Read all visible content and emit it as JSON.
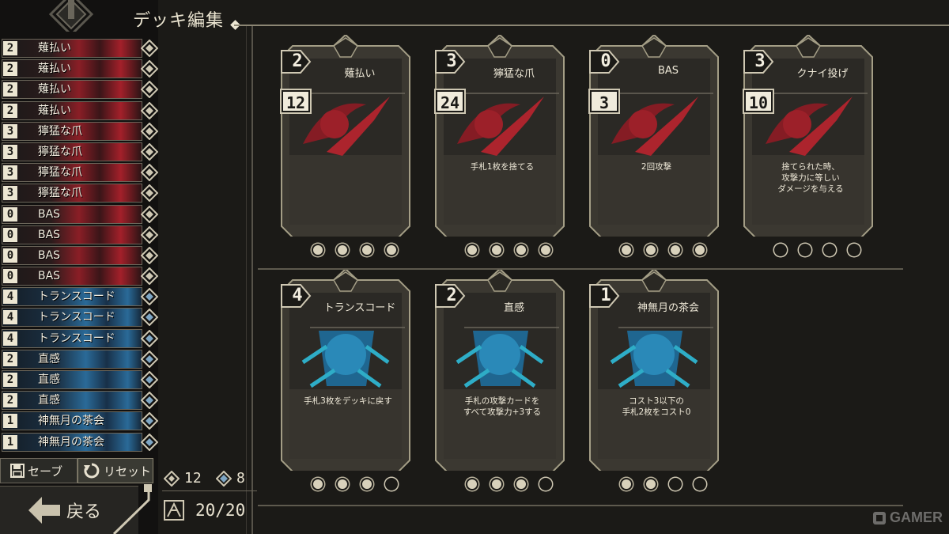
{
  "title": "デッキ編集",
  "deck_list": [
    {
      "cost": "2",
      "name": "薙払い",
      "color": "red"
    },
    {
      "cost": "2",
      "name": "薙払い",
      "color": "red"
    },
    {
      "cost": "2",
      "name": "薙払い",
      "color": "red"
    },
    {
      "cost": "2",
      "name": "薙払い",
      "color": "red"
    },
    {
      "cost": "3",
      "name": "獰猛な爪",
      "color": "red"
    },
    {
      "cost": "3",
      "name": "獰猛な爪",
      "color": "red"
    },
    {
      "cost": "3",
      "name": "獰猛な爪",
      "color": "red"
    },
    {
      "cost": "3",
      "name": "獰猛な爪",
      "color": "red"
    },
    {
      "cost": "0",
      "name": "BAS",
      "color": "red"
    },
    {
      "cost": "0",
      "name": "BAS",
      "color": "red"
    },
    {
      "cost": "0",
      "name": "BAS",
      "color": "red"
    },
    {
      "cost": "0",
      "name": "BAS",
      "color": "red"
    },
    {
      "cost": "4",
      "name": "トランスコード",
      "color": "blue"
    },
    {
      "cost": "4",
      "name": "トランスコード",
      "color": "blue"
    },
    {
      "cost": "4",
      "name": "トランスコード",
      "color": "blue"
    },
    {
      "cost": "2",
      "name": "直感",
      "color": "blue"
    },
    {
      "cost": "2",
      "name": "直感",
      "color": "blue"
    },
    {
      "cost": "2",
      "name": "直感",
      "color": "blue"
    },
    {
      "cost": "1",
      "name": "神無月の茶会",
      "color": "blue"
    },
    {
      "cost": "1",
      "name": "神無月の茶会",
      "color": "blue"
    }
  ],
  "buttons": {
    "save": "セーブ",
    "reset": "リセット",
    "back": "戻る"
  },
  "stats": {
    "red_count": "12",
    "blue_count": "8",
    "deck_count": "20/20"
  },
  "cards": [
    {
      "cost": "2",
      "name": "薙払い",
      "damage": "12",
      "desc": "",
      "color": "red",
      "owned": 4,
      "total": 4
    },
    {
      "cost": "3",
      "name": "獰猛な爪",
      "damage": "24",
      "desc": "手札1枚を捨てる",
      "color": "red",
      "owned": 4,
      "total": 4
    },
    {
      "cost": "0",
      "name": "BAS",
      "damage": "3",
      "desc": "2回攻撃",
      "color": "red",
      "owned": 4,
      "total": 4
    },
    {
      "cost": "3",
      "name": "クナイ投げ",
      "damage": "10",
      "desc": "捨てられた時、\n攻撃力に等しい\nダメージを与える",
      "color": "red",
      "owned": 0,
      "total": 4
    },
    {
      "cost": "4",
      "name": "トランスコード",
      "damage": "",
      "desc": "手札3枚をデッキに戻す",
      "color": "blue",
      "owned": 3,
      "total": 4
    },
    {
      "cost": "2",
      "name": "直感",
      "damage": "",
      "desc": "手札の攻撃カードを\nすべて攻撃力+3する",
      "color": "blue",
      "owned": 3,
      "total": 4
    },
    {
      "cost": "1",
      "name": "神無月の茶会",
      "damage": "",
      "desc": "コスト3以下の\n手札2枚をコスト0",
      "color": "blue",
      "owned": 2,
      "total": 4
    }
  ],
  "watermark": "GAMER",
  "colors": {
    "red": "#b3242e",
    "blue": "#2a8fc0",
    "cream": "#ece6d2",
    "frame": "#a49e86"
  }
}
